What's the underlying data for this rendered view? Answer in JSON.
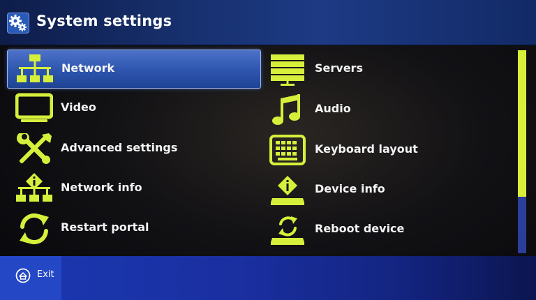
{
  "header": {
    "title": "System settings",
    "icon": "gears-icon"
  },
  "colors": {
    "icon": "#d6ef3b",
    "highlight": "#3a62c0",
    "scroll_thumb": "#d8ef3a",
    "scroll_track": "#2c3e9c"
  },
  "menu": {
    "left": [
      {
        "label": "Network",
        "icon": "network-icon",
        "selected": true
      },
      {
        "label": "Video",
        "icon": "monitor-icon",
        "selected": false
      },
      {
        "label": "Advanced settings",
        "icon": "tools-icon",
        "selected": false
      },
      {
        "label": "Network info",
        "icon": "network-info-icon",
        "selected": false
      },
      {
        "label": "Restart portal",
        "icon": "refresh-icon",
        "selected": false
      }
    ],
    "right": [
      {
        "label": "Servers",
        "icon": "server-icon",
        "selected": false
      },
      {
        "label": "Audio",
        "icon": "music-note-icon",
        "selected": false
      },
      {
        "label": "Keyboard layout",
        "icon": "keyboard-icon",
        "selected": false
      },
      {
        "label": "Device info",
        "icon": "device-info-icon",
        "selected": false
      },
      {
        "label": "Reboot device",
        "icon": "reboot-device-icon",
        "selected": false
      }
    ]
  },
  "scrollbar": {
    "position_fraction": 0.0,
    "visible_fraction": 0.72
  },
  "footer": {
    "exit_label": "Exit",
    "exit_icon": "exit-icon"
  }
}
